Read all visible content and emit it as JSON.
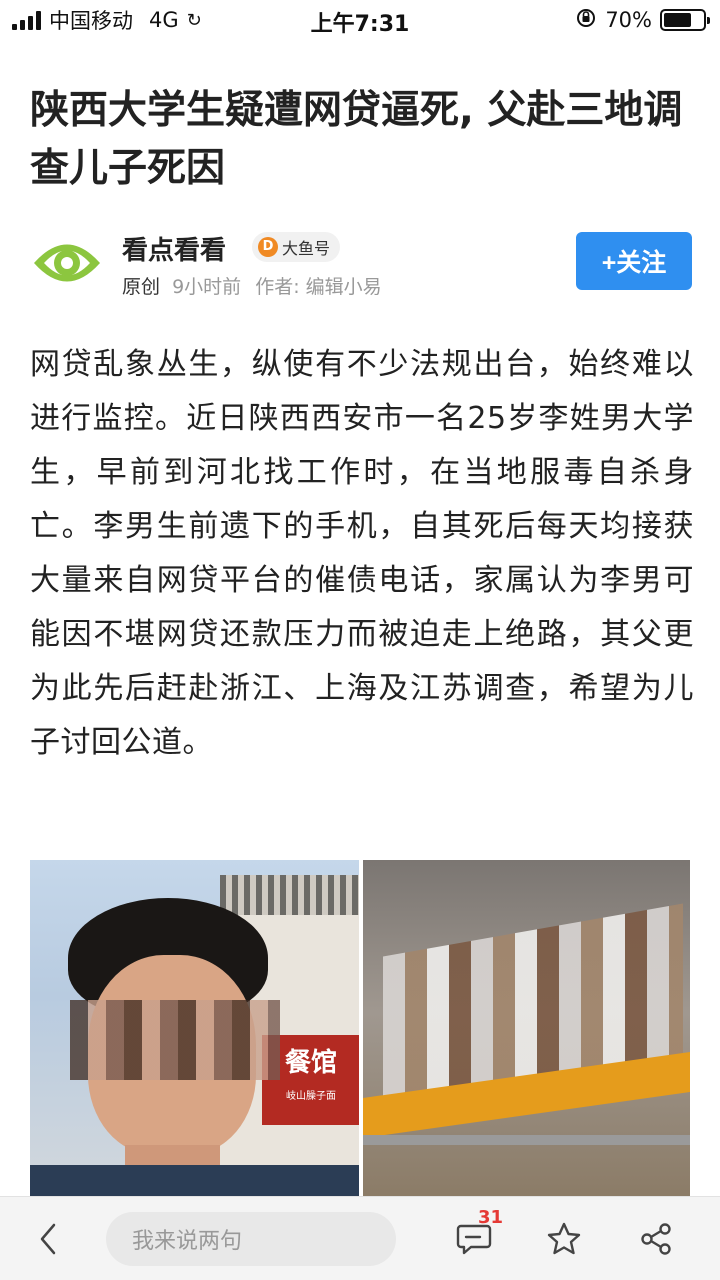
{
  "status_bar": {
    "carrier": "中国移动",
    "network": "4G",
    "time": "上午7:31",
    "battery_percent": "70%",
    "battery_level": 0.7
  },
  "article": {
    "title": "陕西大学生疑遭网贷逼死, 父赴三地调查儿子死因",
    "author": "看点看看",
    "platform_badge": "大鱼号",
    "original_label": "原创",
    "time_ago": "9小时前",
    "byline": "作者: 编辑小易",
    "follow_label": "+关注",
    "body": "网贷乱象丛生，纵使有不少法规出台，始终难以进行监控。近日陕西西安市一名25岁李姓男大学生，早前到河北找工作时，在当地服毒自杀身亡。李男生前遗下的手机，自其死后每天均接获大量来自网贷平台的催债电话，家属认为李男可能因不堪网贷还款压力而被迫走上绝路，其父更为此先后赶赴浙江、上海及江苏调查，希望为儿子讨回公道。",
    "photo_sign_text": "餐馆",
    "photo_sign_small": "岐山臊子面"
  },
  "bottom_bar": {
    "comment_placeholder": "我来说两句",
    "comment_count": "31"
  },
  "colors": {
    "accent": "#2f8ff0",
    "logo_green": "#8cc63f",
    "badge_red": "#e53935"
  }
}
